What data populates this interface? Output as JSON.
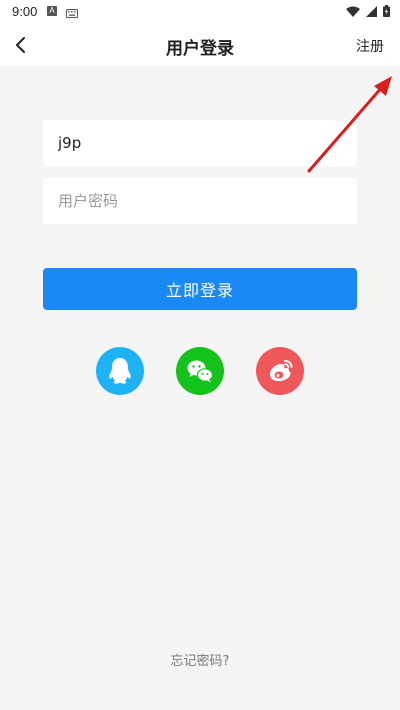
{
  "status_bar": {
    "time": "9:00",
    "notification_icon_letter": "A",
    "icons": [
      "notification-a-icon",
      "keyboard-icon",
      "wifi-icon",
      "signal-icon",
      "battery-icon"
    ]
  },
  "header": {
    "title": "用户登录",
    "register_label": "注册"
  },
  "form": {
    "username_value": "j9p",
    "password_placeholder": "用户密码",
    "login_label": "立即登录"
  },
  "social_login": [
    {
      "name": "qq",
      "icon": "qq-icon",
      "color": "#1fb2f5"
    },
    {
      "name": "wechat",
      "icon": "wechat-icon",
      "color": "#13c31b"
    },
    {
      "name": "weibo",
      "icon": "weibo-icon",
      "color": "#f0575a"
    }
  ],
  "forgot_password": "忘记密码?",
  "colors": {
    "accent": "#1a88f5",
    "background": "#f5f5f5",
    "annotation": "#d81e1e"
  }
}
